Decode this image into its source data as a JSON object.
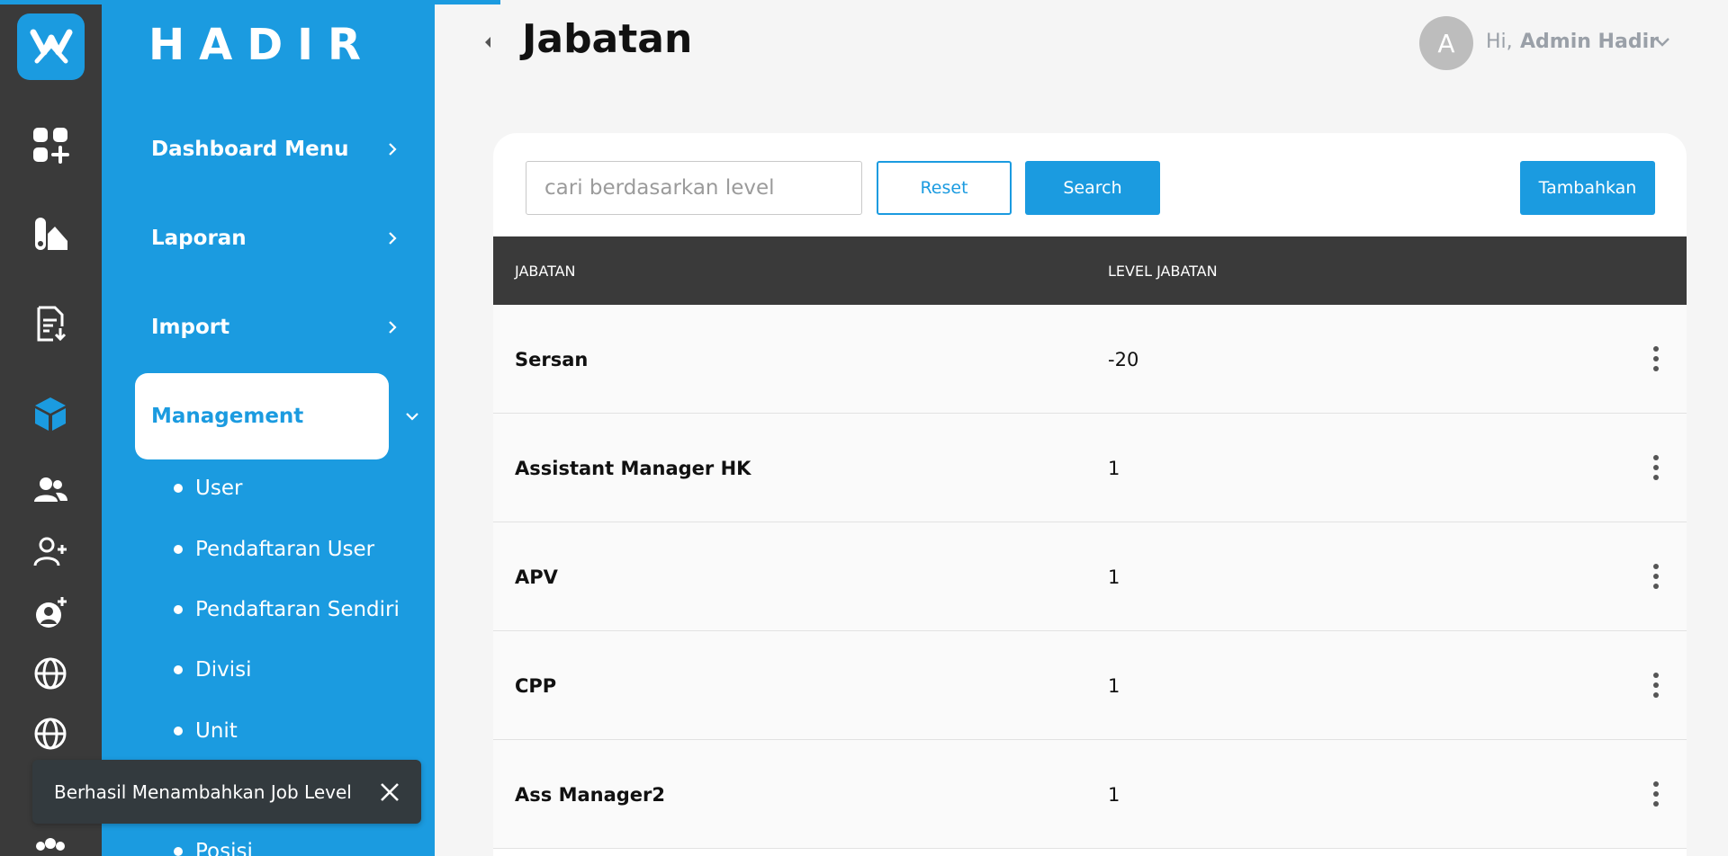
{
  "brand": "HADIR",
  "rail": {
    "icons": [
      "dashboard-add-icon",
      "report-icon",
      "document-import-icon",
      "management-cube-icon",
      "users-icon",
      "user-add-icon",
      "user-gear-icon",
      "globe-icon",
      "globe-alt-icon",
      "gear-icon",
      "team-icon"
    ],
    "active_icon": "management-cube-icon"
  },
  "sidebar": {
    "menus": [
      {
        "label": "Dashboard Menu",
        "expanded": false
      },
      {
        "label": "Laporan",
        "expanded": false
      },
      {
        "label": "Import",
        "expanded": false
      },
      {
        "label": "Management",
        "expanded": true
      }
    ],
    "submenu": [
      "User",
      "Pendaftaran User",
      "Pendaftaran Sendiri",
      "Divisi",
      "Unit",
      "Posisi"
    ]
  },
  "header": {
    "title": "Jabatan",
    "avatar_initial": "A",
    "greeting": "Hi,",
    "user_name": "Admin Hadir"
  },
  "toolbar": {
    "search_placeholder": "cari berdasarkan level",
    "search_value": "",
    "reset_label": "Reset",
    "search_label": "Search",
    "add_label": "Tambahkan"
  },
  "table": {
    "columns": [
      "JABATAN",
      "LEVEL JABATAN"
    ],
    "rows": [
      {
        "jabatan": "Sersan",
        "level": "-20"
      },
      {
        "jabatan": "Assistant Manager HK",
        "level": "1"
      },
      {
        "jabatan": "APV",
        "level": "1"
      },
      {
        "jabatan": "CPP",
        "level": "1"
      },
      {
        "jabatan": "Ass Manager2",
        "level": "1"
      }
    ]
  },
  "toast": {
    "message": "Berhasil Menambahkan Job Level"
  },
  "colors": {
    "accent": "#1b9be0",
    "rail_bg": "#3a3a3a",
    "table_header_bg": "#3a3a3a",
    "toast_bg": "#333a3e"
  }
}
